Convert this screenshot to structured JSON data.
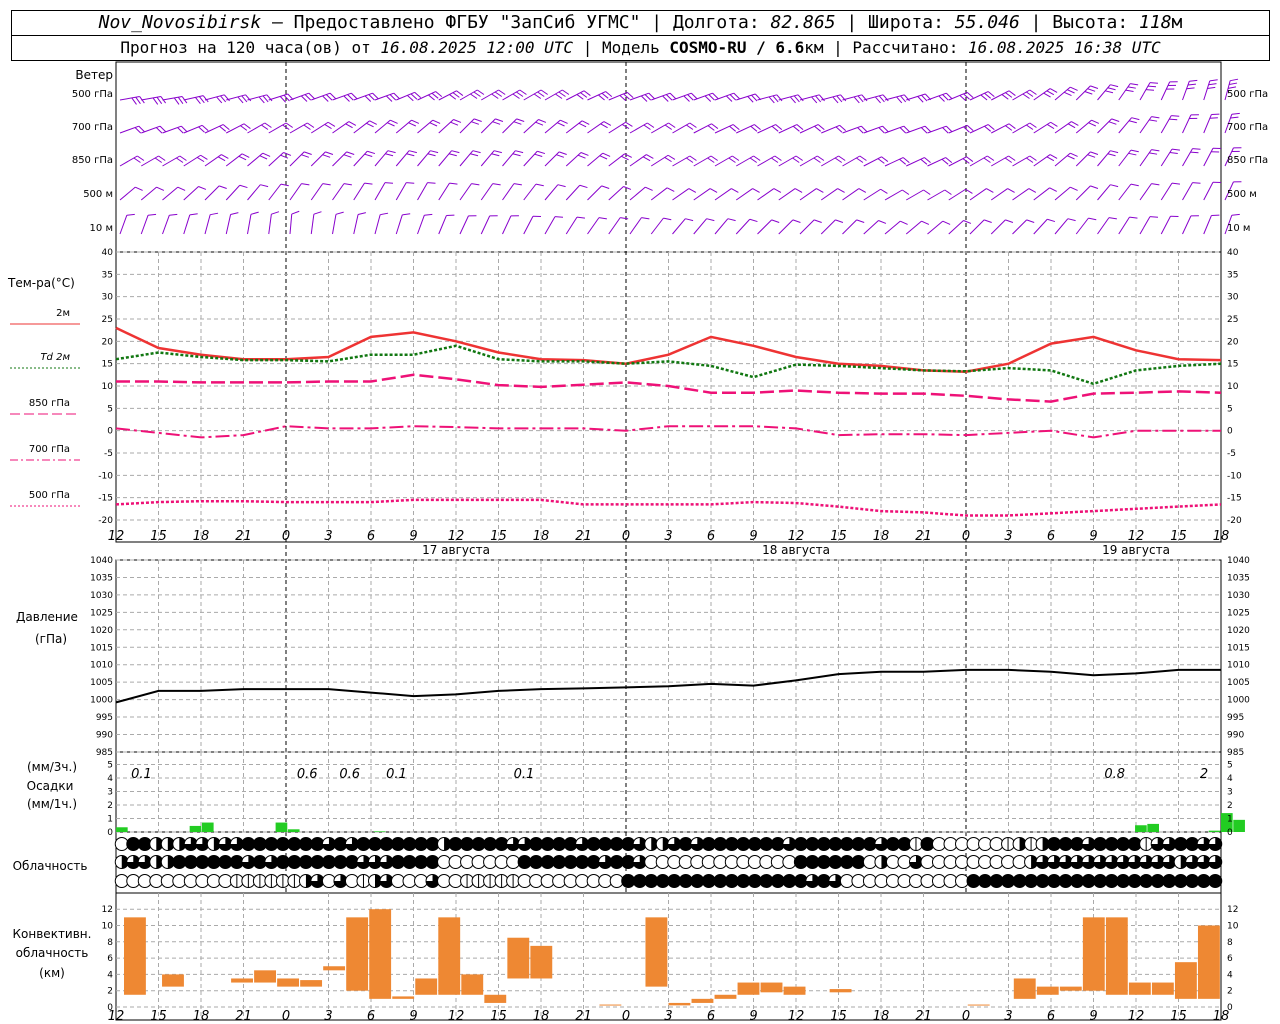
{
  "header": {
    "station": "Nov_Novosibirsk",
    "provider": " – Предоставлено ФГБУ \"ЗапСиб УГМС\" | Долгота: ",
    "lon": "82.865",
    "lat_label": " | Широта: ",
    "lat": "55.046",
    "alt_label": " | Высота: ",
    "alt": "118",
    "alt_unit": "м",
    "forecast_label": "Прогноз на 120 часа(ов) от ",
    "forecast_time": "16.08.2025 12:00 UTC",
    "model_label": " | Модель ",
    "model": "COSMO-RU / 6.6",
    "model_unit": "км",
    "calc_label": " | Рассчитано: ",
    "calc_time": "16.08.2025 16:38 UTC"
  },
  "wind_panel": {
    "title": "Ветер",
    "levels": [
      "500 гПа",
      "700 гПа",
      "850 гПа",
      "500 м",
      "10  м"
    ],
    "color": "#8800cc"
  },
  "x_axis": {
    "ticks": [
      "12",
      "15",
      "18",
      "21",
      "0",
      "3",
      "6",
      "9",
      "12",
      "15",
      "18",
      "21",
      "0",
      "3",
      "6",
      "9",
      "12",
      "15",
      "18",
      "21",
      "0",
      "3",
      "6",
      "9",
      "12",
      "15",
      "18"
    ],
    "days": [
      "17 августа",
      "18 августа",
      "19 августа"
    ]
  },
  "temp_panel": {
    "title": "Тем-ра(°С)",
    "legend": [
      "2м",
      "Td  2м",
      "850 гПа",
      "700 гПа",
      "500 гПа"
    ],
    "legend_colors": [
      "#ee3333",
      "#117711",
      "#ee1177",
      "#ee1177",
      "#ee1177"
    ],
    "y_ticks": [
      "40",
      "35",
      "30",
      "25",
      "20",
      "15",
      "10",
      "5",
      "0",
      "-5",
      "-10",
      "-15",
      "-20"
    ]
  },
  "pressure_panel": {
    "title": "Давление",
    "unit": "(гПа)",
    "y_ticks": [
      "1040",
      "1035",
      "1030",
      "1025",
      "1020",
      "1015",
      "1010",
      "1005",
      "1000",
      "995",
      "990",
      "985"
    ]
  },
  "precip_panel": {
    "unit3": "(мм/3ч.)",
    "title": "Осадки",
    "unit1": "(мм/1ч.)",
    "y_ticks": [
      "5",
      "4",
      "3",
      "2",
      "1",
      "0"
    ],
    "totals": [
      "0.1",
      "0.6",
      "0.6",
      "0.1",
      "0.1",
      "0.8",
      "2"
    ],
    "color": "#22cc22"
  },
  "cloud_panel": {
    "title": "Облачность"
  },
  "conv_panel": {
    "title1": "Конвективн.",
    "title2": "облачность",
    "unit": "(км)",
    "y_ticks": [
      "12",
      "10",
      "8",
      "6",
      "4",
      "2",
      "0"
    ],
    "color": "#ee8833"
  },
  "chart_data": {
    "type": "line",
    "x": [
      "16.08 12",
      "16.08 15",
      "16.08 18",
      "16.08 21",
      "17.08 00",
      "17.08 03",
      "17.08 06",
      "17.08 09",
      "17.08 12",
      "17.08 15",
      "17.08 18",
      "17.08 21",
      "18.08 00",
      "18.08 03",
      "18.08 06",
      "18.08 09",
      "18.08 12",
      "18.08 15",
      "18.08 18",
      "18.08 21",
      "19.08 00",
      "19.08 03",
      "19.08 06",
      "19.08 09",
      "19.08 12",
      "19.08 15",
      "19.08 18"
    ],
    "series": [
      {
        "name": "2м",
        "values": [
          23,
          18.5,
          17,
          16,
          16,
          16.5,
          21,
          22,
          20,
          17.5,
          16,
          15.8,
          15,
          17,
          21,
          19,
          16.5,
          15,
          14.5,
          13.5,
          13.2,
          15,
          19.5,
          21,
          18,
          16,
          15.8
        ]
      },
      {
        "name": "Td  2м",
        "values": [
          16,
          17.5,
          16.5,
          15.8,
          15.8,
          15.5,
          17,
          17,
          19,
          16,
          15.5,
          15.5,
          15,
          15.5,
          14.5,
          12,
          14.8,
          14.5,
          14,
          13.5,
          13.3,
          14,
          13.5,
          10.5,
          13.5,
          14.5,
          15
        ]
      },
      {
        "name": "850 гПа",
        "values": [
          11,
          11,
          10.8,
          10.8,
          10.8,
          11,
          11,
          12.5,
          11.5,
          10.2,
          9.8,
          10.3,
          10.8,
          10,
          8.5,
          8.5,
          9,
          8.5,
          8.3,
          8.3,
          7.8,
          7,
          6.5,
          8.3,
          8.5,
          8.8,
          8.5
        ]
      },
      {
        "name": "700 гПа",
        "values": [
          0.5,
          -0.5,
          -1.5,
          -1,
          1,
          0.5,
          0.5,
          1,
          0.8,
          0.5,
          0.5,
          0.5,
          0,
          1,
          1,
          1,
          0.5,
          -1,
          -0.8,
          -0.8,
          -1,
          -0.5,
          0,
          -1.5,
          0,
          0,
          0
        ]
      },
      {
        "name": "500 гПа",
        "values": [
          -16.5,
          -16,
          -15.8,
          -15.8,
          -16,
          -16,
          -16,
          -15.5,
          -15.5,
          -15.5,
          -15.5,
          -16.5,
          -16.5,
          -16.5,
          -16.5,
          -16,
          -16.2,
          -17,
          -18,
          -18.3,
          -19,
          -19,
          -18.5,
          -18,
          -17.5,
          -17,
          -16.5
        ]
      },
      {
        "name": "Давление",
        "values": [
          999.2,
          1002.5,
          1002.5,
          1003,
          1003,
          1003,
          1002,
          1001,
          1001.5,
          1002.5,
          1003,
          1003.2,
          1003.5,
          1003.8,
          1004.5,
          1004,
          1005.5,
          1007.3,
          1008,
          1008,
          1008.5,
          1008.5,
          1008,
          1007,
          1007.5,
          1008.5,
          1008.5
        ]
      }
    ],
    "temp_ylim": [
      -20,
      40
    ],
    "pressure_ylim": [
      985,
      1040
    ],
    "precip_mm_1h": [
      0.35,
      0,
      0,
      0,
      0,
      0,
      0.45,
      0.7,
      0,
      0,
      0,
      0,
      0,
      0.7,
      0.2,
      0,
      0,
      0,
      0,
      0,
      0,
      0.05,
      0,
      0,
      0,
      0,
      0,
      0,
      0,
      0,
      0,
      0,
      0,
      0,
      0,
      0,
      0,
      0,
      0,
      0,
      0,
      0,
      0,
      0,
      0,
      0,
      0,
      0,
      0,
      0,
      0,
      0,
      0,
      0,
      0,
      0,
      0,
      0,
      0,
      0,
      0,
      0,
      0,
      0,
      0,
      0,
      0,
      0,
      0,
      0,
      0,
      0,
      0,
      0,
      0,
      0,
      0,
      0,
      0,
      0,
      0,
      0,
      0,
      0.5,
      0.6,
      0,
      0,
      0,
      0,
      0.1,
      1.4,
      0.9
    ],
    "conv_cloud_km": [
      [
        1.5,
        11
      ],
      null,
      [
        2.5,
        4
      ],
      null,
      null,
      [
        3,
        3.5
      ],
      [
        3,
        4.5
      ],
      [
        2.5,
        3.5
      ],
      [
        2.5,
        3.3
      ],
      [
        4.5,
        5
      ],
      [
        2,
        11
      ],
      [
        1,
        12
      ],
      [
        1,
        1.3
      ],
      [
        1.5,
        3.5
      ],
      [
        1.5,
        11
      ],
      [
        1.5,
        4
      ],
      [
        0.5,
        1.5
      ],
      [
        3.5,
        8.5
      ],
      [
        3.5,
        7.5
      ],
      null,
      null,
      [
        0.2,
        0.3
      ],
      null,
      [
        2.5,
        11
      ],
      [
        0.2,
        0.5
      ],
      [
        0.5,
        1
      ],
      [
        1,
        1.5
      ],
      [
        1.5,
        3
      ],
      [
        1.8,
        3
      ],
      [
        1.5,
        2.5
      ],
      null,
      [
        1.8,
        2.2
      ],
      null,
      null,
      null,
      null,
      null,
      [
        0.2,
        0.3
      ],
      null,
      [
        1,
        3.5
      ],
      [
        1.5,
        2.5
      ],
      [
        2,
        2.5
      ],
      [
        2,
        11
      ],
      [
        1.5,
        11
      ],
      [
        1.5,
        3
      ],
      [
        1.5,
        3
      ],
      [
        1,
        5.5
      ],
      [
        1,
        10
      ]
    ]
  }
}
